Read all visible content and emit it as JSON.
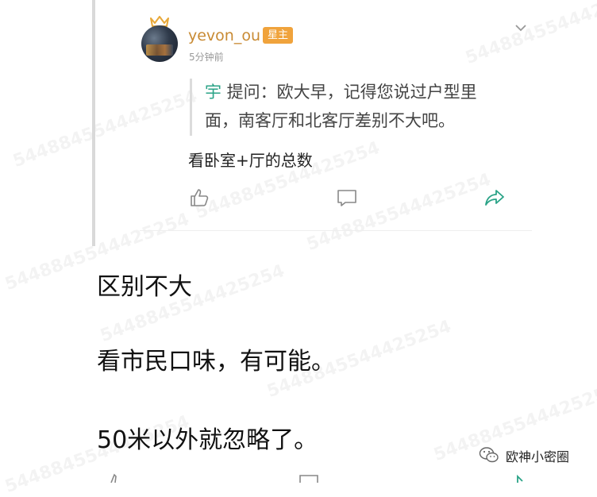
{
  "post": {
    "username": "yevon_ou",
    "badge": "星主",
    "timestamp": "5分钟前",
    "quote_author": "宇",
    "quote_line1": " 提问：欧大早，记得您说过户型里",
    "quote_line2": "面，南客厅和北客厅差别不大吧。",
    "comment": "看卧室+厅的总数"
  },
  "answer": {
    "line1": "区别不大",
    "line2": "看市民口味，有可能。",
    "line3": "50米以外就忽略了。"
  },
  "watermark": {
    "text": "5448845544425254"
  },
  "source": {
    "name": "欧神小密圈",
    "icon": "wechat-icon"
  },
  "colors": {
    "username": "#c88a33",
    "badge": "#f0a33c",
    "quote_name": "#2aa387",
    "share": "#2aa387"
  },
  "icons": {
    "like": "thumbs-up-icon",
    "comment": "comment-bubble-icon",
    "share": "share-arrow-icon",
    "collapse": "chevron-down-icon"
  }
}
